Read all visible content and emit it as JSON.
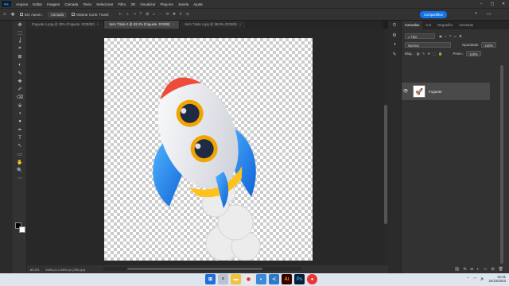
{
  "menubar": {
    "logo": "Ps",
    "items": [
      "Arquivo",
      "Editar",
      "Imagem",
      "Camada",
      "Texto",
      "Selecionar",
      "Filtro",
      "3D",
      "Visualizar",
      "Plug-ins",
      "Janela",
      "Ajuda"
    ]
  },
  "options": {
    "auto_select": "Sel. Autom.:",
    "layer_select": "Camada",
    "transform": "Mostrar Contr. Transf.",
    "share": "Compartilhar"
  },
  "tabs": [
    {
      "label": "Foguete-1.png @ 33% (Foguete, RGB/8#)",
      "active": false
    },
    {
      "label": "Sem Título-2 @ 83,3% (Foguete, RGB/8)",
      "active": true
    },
    {
      "label": "Sem Título-1.jpg @ 58,9% (RGB/8)",
      "active": false
    }
  ],
  "tools": [
    "✥",
    "⬚",
    "ʆ",
    "⌗",
    "⊠",
    "◐",
    "✎",
    "✚",
    "✐",
    "⌫",
    "⬙",
    "◖",
    "●",
    "✒",
    "T",
    "↖",
    "▭",
    "✋",
    "🔍",
    "⋯"
  ],
  "status": {
    "zoom": "83,3%",
    "doc": "2000 px x 2000 px (300 ppi)"
  },
  "layers_panel": {
    "tabs": [
      "Camadas",
      "Cor",
      "Degradês",
      "Amostras"
    ],
    "kind_filter": "Tipo",
    "blend_mode": "Normal",
    "opacity_label": "Opacidade:",
    "opacity_value": "100%",
    "lock_label": "Bloq.:",
    "fill_label": "Preen.:",
    "fill_value": "100%",
    "layer_name": "Foguete"
  },
  "taskbar": {
    "time": "22:31",
    "date": "24/10/2023"
  },
  "colors": {
    "accent": "#1473e6",
    "panel": "#323232",
    "workspace": "#282828"
  }
}
